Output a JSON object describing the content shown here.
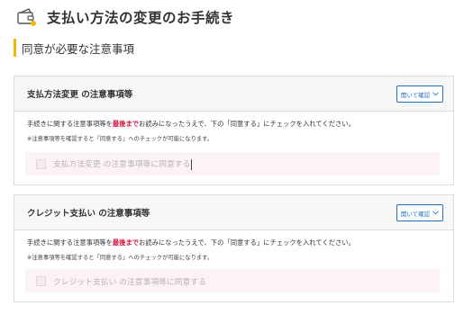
{
  "page": {
    "title": "支払い方法の変更のお手続き",
    "section_heading": "同意が必要な注意事項"
  },
  "cards": [
    {
      "title": "支払方法変更 の注意事項等",
      "open_button": "開いて確認",
      "instruction_before": "手続きに関する注意事項等を",
      "instruction_emphasis": "最後まで",
      "instruction_after": "お読みになったうえで、下の「同意する」にチェックを入れてください。",
      "note": "※注意事項等を確認すると「同意する」へのチェックが可能になります。",
      "agree_label": "支払方法変更 の注意事項等に同意する",
      "checked": false
    },
    {
      "title": "クレジット支払い の注意事項等",
      "open_button": "開いて確認",
      "instruction_before": "手続きに関する注意事項等を",
      "instruction_emphasis": "最後まで",
      "instruction_after": "お読みになったうえで、下の「同意する」にチェックを入れてください。",
      "note": "※注意事項等を確認すると「同意する」へのチェックが可能になります。",
      "agree_label": "クレジット支払い の注意事項等に同意する",
      "checked": false
    }
  ],
  "colors": {
    "accent_bar": "#f2b705",
    "button_blue": "#1f6fbf",
    "emphasis_red": "#d4143c",
    "agree_bg": "#fcf4f4"
  },
  "icons": {
    "header": "wallet-icon",
    "button": "chevron-down-icon"
  }
}
